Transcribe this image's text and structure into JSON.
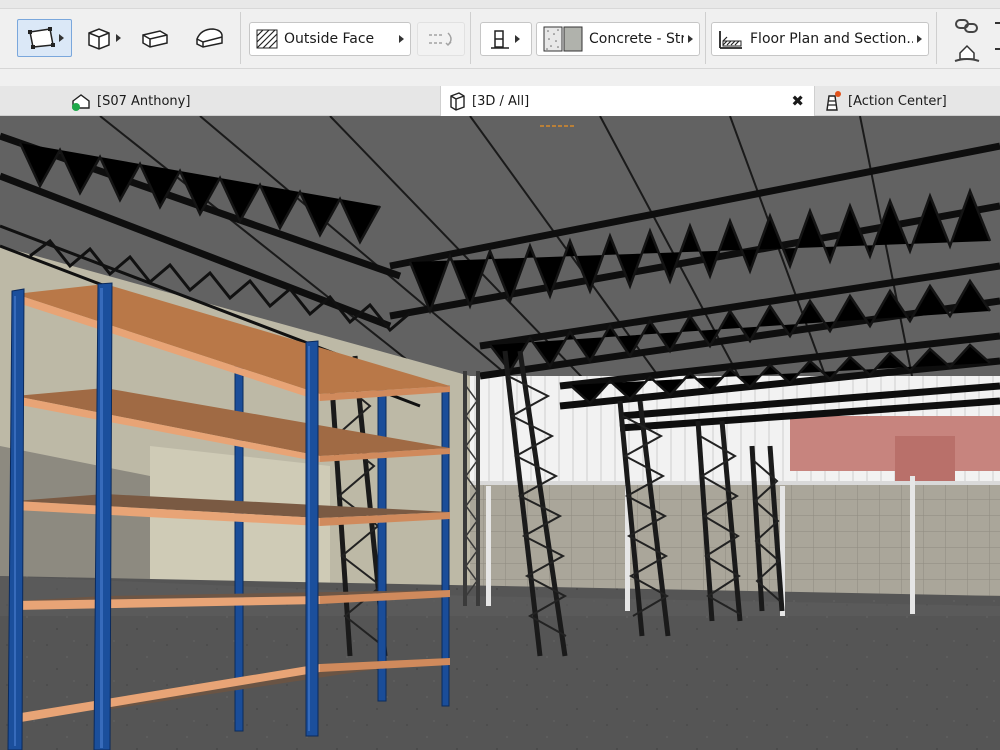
{
  "toolbar": {
    "surface_dropdown": {
      "label": "Outside Face"
    },
    "material_dropdown": {
      "label": "Concrete - Str..."
    },
    "display_dropdown": {
      "label": "Floor Plan and Section..."
    },
    "tool_icons": [
      "polygon-geometry-icon",
      "box-3d-icon",
      "slab-icon",
      "roof-icon",
      "flip-icon",
      "structure-icon",
      "hatch-swatch-icon",
      "floor-plan-icon",
      "link-icon",
      "home-icon"
    ]
  },
  "tabs": [
    {
      "label": "[S07 Anthony]",
      "icon": "floor-plan-view-icon"
    },
    {
      "label": "[3D / All]",
      "icon": "3d-view-icon",
      "active": true
    },
    {
      "label": "[Action Center]",
      "icon": "action-center-icon"
    }
  ],
  "colors": {
    "rack_upright": "#1b4f9c",
    "rack_shelf": "#b8774a",
    "truss": "#111111",
    "roof": "#5e5e5e",
    "floor": "#4f4f4f",
    "wall_block": "#a8a497",
    "brick_band": "#c8837d"
  }
}
